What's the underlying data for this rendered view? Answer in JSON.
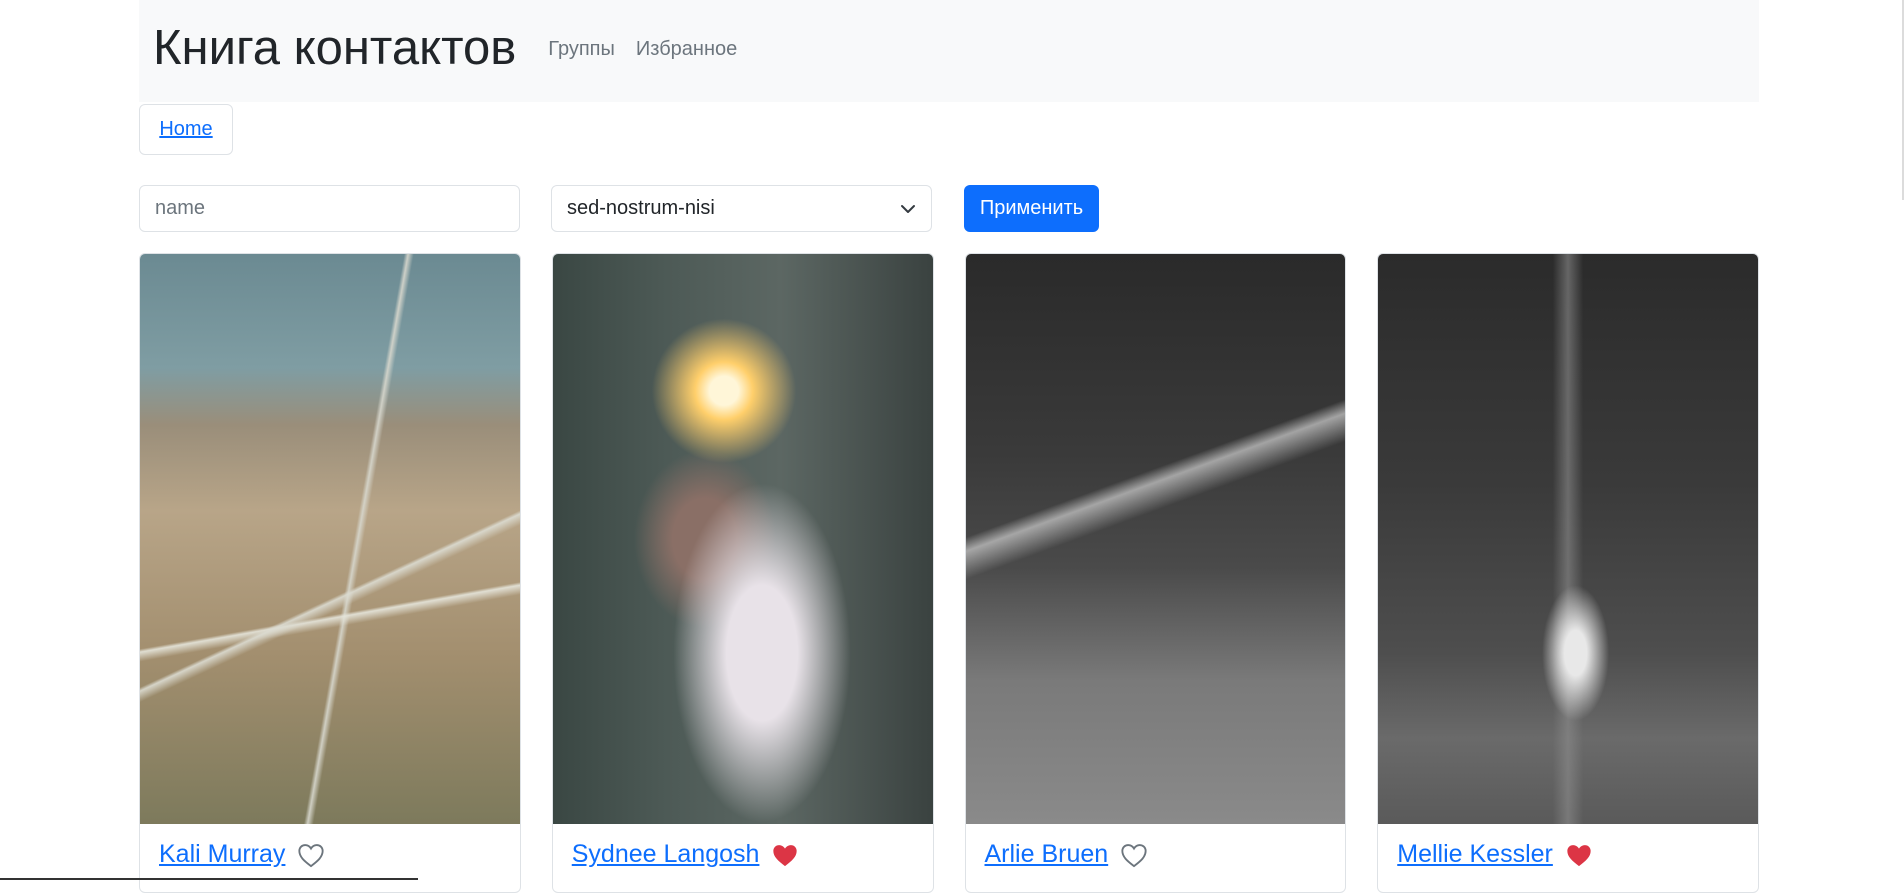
{
  "nav": {
    "brand": "Книга контактов",
    "links": [
      "Группы",
      "Избранное"
    ]
  },
  "breadcrumb": {
    "home": "Home"
  },
  "filters": {
    "name_placeholder": "name",
    "group_selected": "sed-nostrum-nisi",
    "apply_label": "Применить"
  },
  "contacts": [
    {
      "name": "Kali Murray",
      "favorite": false,
      "photo": "aerial-highway-photo"
    },
    {
      "name": "Sydnee Langosh",
      "favorite": true,
      "photo": "sparkler-photo"
    },
    {
      "name": "Arlie Bruen",
      "favorite": false,
      "photo": "forest-road-photo"
    },
    {
      "name": "Mellie Kessler",
      "favorite": true,
      "photo": "tree-tunnel-photo"
    }
  ],
  "colors": {
    "link": "#0d6efd",
    "primary": "#0d6efd",
    "favorite_heart": "#dc3545",
    "navbar_bg": "#f8f9fa"
  }
}
